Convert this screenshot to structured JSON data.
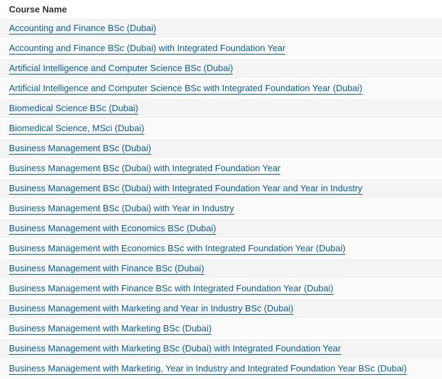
{
  "table": {
    "header": "Course Name",
    "colors": {
      "link": "#0a5e8c",
      "header_text": "#333333",
      "row_odd": "#f4f4f4",
      "row_even": "#fbfbfb"
    },
    "courses": [
      "Accounting and Finance BSc (Dubai)",
      "Accounting and Finance BSc (Dubai) with Integrated Foundation Year",
      "Artificial Intelligence and Computer Science BSc (Dubai)",
      "Artificial Intelligence and Computer Science BSc with Integrated Foundation Year (Dubai)",
      "Biomedical Science BSc (Dubai)",
      "Biomedical Science, MSci (Dubai)",
      "Business Management BSc (Dubai)",
      "Business Management BSc (Dubai) with Integrated Foundation Year",
      "Business Management BSc (Dubai) with Integrated Foundation Year and Year in Industry",
      "Business Management BSc (Dubai) with Year in Industry",
      "Business Management with Economics BSc (Dubai)",
      "Business Management with Economics BSc with Integrated Foundation Year (Dubai)",
      "Business Management with Finance BSc (Dubai)",
      "Business Management with Finance BSc with Integrated Foundation Year (Dubai)",
      "Business Management with Marketing and Year in Industry BSc (Dubai)",
      "Business Management with Marketing BSc (Dubai)",
      "Business Management with Marketing BSc (Dubai) with Integrated Foundation Year",
      "Business Management with Marketing, Year in Industry and Integrated Foundation Year BSc (Dubai)"
    ]
  }
}
